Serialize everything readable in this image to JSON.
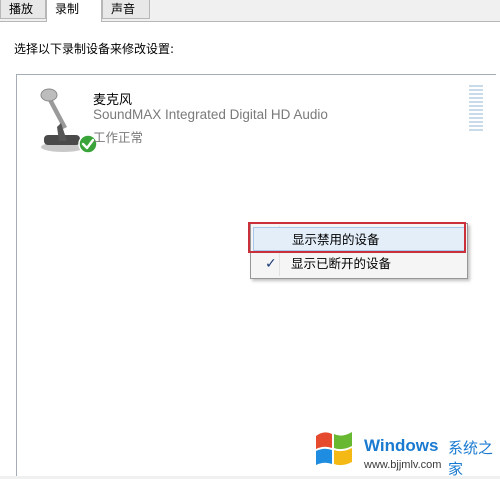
{
  "tabs": [
    {
      "label": "播放"
    },
    {
      "label": "录制"
    },
    {
      "label": "声音"
    }
  ],
  "instruction": "选择以下录制设备来修改设置:",
  "device": {
    "name": "麦克风",
    "driver": "SoundMAX Integrated Digital HD Audio",
    "status": "工作正常",
    "icon": "microphone-icon",
    "default_badge": "green-check-icon"
  },
  "context_menu": {
    "items": [
      {
        "label": "显示禁用的设备",
        "checked": false,
        "highlighted": true
      },
      {
        "label": "显示已断开的设备",
        "checked": true,
        "highlighted": false
      }
    ],
    "check_mark": "✓"
  },
  "watermark": {
    "brand": "Windows",
    "suffix": "系统之家",
    "url": "www.bjjmlv.com"
  },
  "colors": {
    "highlight_outline": "#c9303a",
    "status_green": "#3aa43a",
    "watermark_blue": "#1a7ad0"
  }
}
